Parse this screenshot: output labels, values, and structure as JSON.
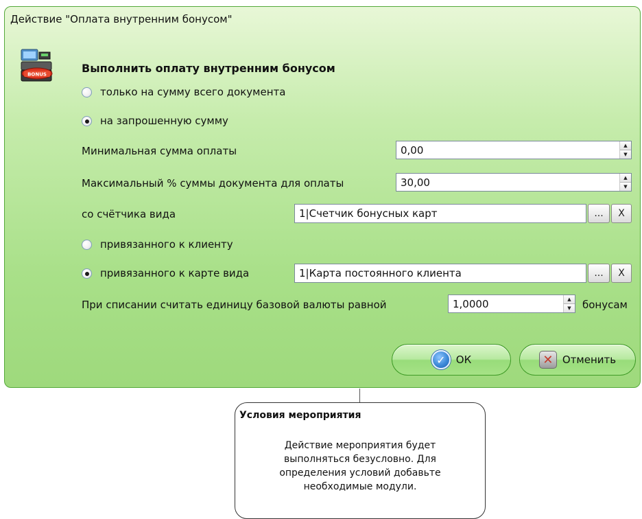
{
  "dialog": {
    "title": "Действие \"Оплата внутренним бонусом\"",
    "heading": "Выполнить оплату внутренним бонусом",
    "icon": "pos-terminal-bonus-icon"
  },
  "payment_mode": {
    "option_full": "только на сумму всего документа",
    "option_requested": "на запрошенную сумму",
    "selected": "option_requested"
  },
  "min_sum": {
    "label": "Минимальная сумма оплаты",
    "value": "0,00"
  },
  "max_percent": {
    "label": "Максимальный % суммы документа для оплаты",
    "value": "30,00"
  },
  "counter": {
    "label": "со счётчика вида",
    "value": "1|Счетчик бонусных карт",
    "browse_label": "...",
    "clear_label": "X"
  },
  "binding": {
    "option_client": "привязанного к клиенту",
    "option_card": "привязанного к карте вида",
    "selected": "option_card",
    "card_value": "1|Карта постоянного клиента",
    "browse_label": "...",
    "clear_label": "X"
  },
  "rate": {
    "label": "При списании считать единицу базовой валюты равной",
    "value": "1,0000",
    "suffix": "бонусам"
  },
  "buttons": {
    "ok": "ОК",
    "cancel": "Отменить"
  },
  "tooltip": {
    "title": "Условия мероприятия",
    "body": "Действие мероприятия будет\nвыполняться безусловно. Для\nопределения условий добавьте\nнеобходимые модули."
  },
  "colors": {
    "dialog_green": "#a9e089",
    "border_green": "#54a83a"
  }
}
